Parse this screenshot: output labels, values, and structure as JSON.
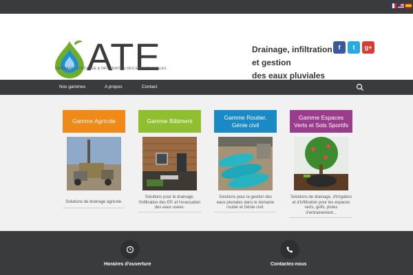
{
  "languages": [
    "fr",
    "en",
    "es"
  ],
  "header": {
    "logo_text": "ATE",
    "logo_subtitle": "DRAINAGE, STOCKAGE & INFILTRATION DES EAUX PLUVIALES",
    "tagline_lines": [
      "Drainage, infiltration",
      "et gestion",
      "des eaux pluviales"
    ]
  },
  "social": [
    {
      "icon": "facebook-icon",
      "glyph": "f",
      "color": "#3b5998"
    },
    {
      "icon": "twitter-icon",
      "glyph": "t",
      "color": "#29a9e1"
    },
    {
      "icon": "google-plus-icon",
      "glyph": "g+",
      "color": "#d73d32"
    }
  ],
  "nav": {
    "items": [
      "Nos gammes",
      "A propos",
      "Contact"
    ],
    "search_icon": "search-icon"
  },
  "products": [
    {
      "title": "Gamme Agricole",
      "color": "#ef8a18",
      "description": "Solutions de drainage agricole.",
      "image": "drilling-machine-photo"
    },
    {
      "title": "Gamme Bâtiment",
      "color": "#8fbf2f",
      "description": "Solutions pour le drainage, l'infiltration des EP, et l'evacuation des eaux usees.",
      "image": "building-drain-photo"
    },
    {
      "title": "Gamme Routier, Génie civil",
      "color": "#1a8ac6",
      "description": "Solutions pour la gestion des eaux pluviales dans le domaine routier et Génie civil.",
      "image": "storage-tanks-photo"
    },
    {
      "title": "Gamme Espaces Verts et Sols Sportifs",
      "color": "#9b3b8c",
      "description": "Solutions de drainage, d'irrigation et d'infiltration pour les espaces verts, golfs, pistes d'entrainement...",
      "image": "tree-root-photo"
    }
  ],
  "footer": {
    "hours_icon": "clock-icon",
    "hours_title": "Horaires d'ouverture",
    "contact_icon": "phone-icon",
    "contact_title": "Contactez-nous"
  }
}
